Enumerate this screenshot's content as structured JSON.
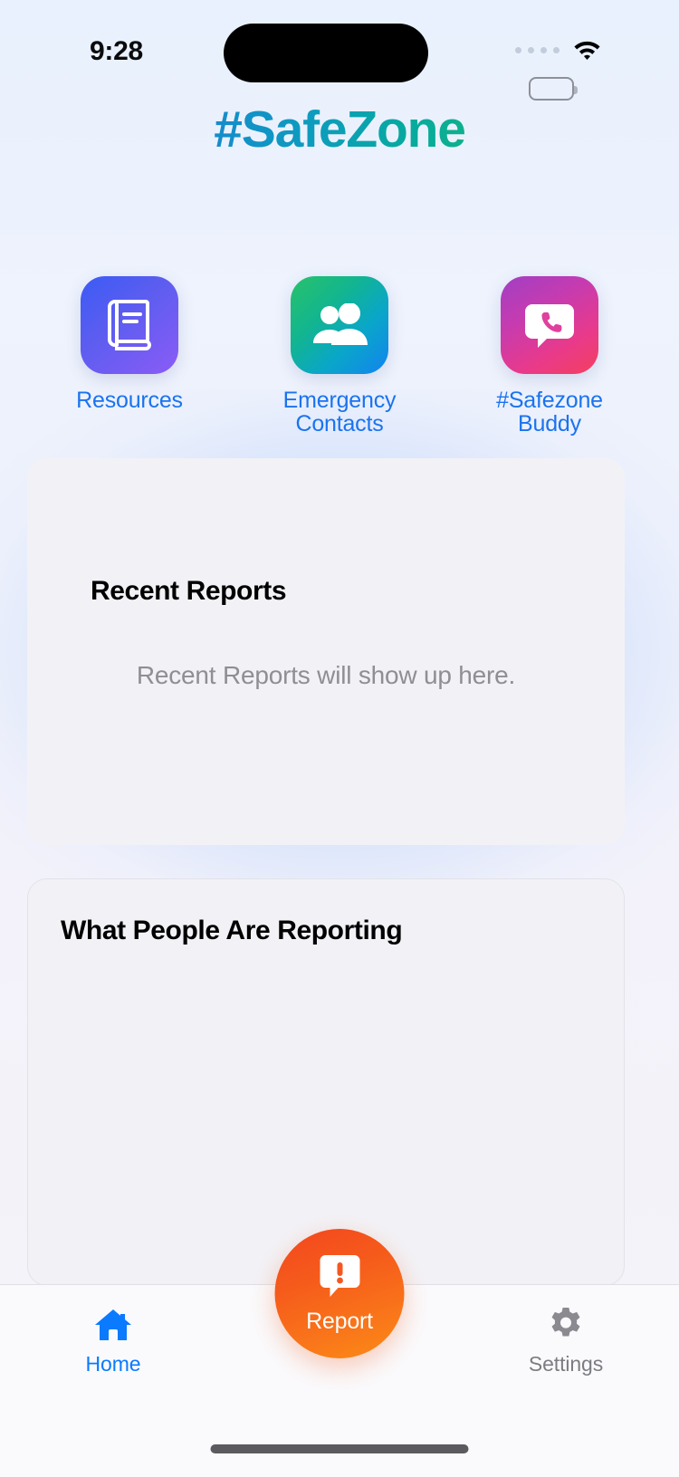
{
  "status_bar": {
    "time": "9:28",
    "signal_icon": "signal-dots-icon",
    "wifi_icon": "wifi-icon",
    "battery_icon": "battery-icon"
  },
  "header": {
    "title": "#SafeZone",
    "title_gradient_from": "#2563eb",
    "title_gradient_to": "#34c759"
  },
  "quick_actions": [
    {
      "label": "Resources",
      "icon": "book-icon",
      "gradient_from": "#3b5bf5",
      "gradient_to": "#8b5cf6"
    },
    {
      "label": "Emergency Contacts",
      "icon": "people-icon",
      "gradient_from": "#29c26a",
      "gradient_to": "#1283f0"
    },
    {
      "label": "#Safezone Buddy",
      "icon": "phone-chat-icon",
      "gradient_from": "#a13fc4",
      "gradient_to": "#f43f5e"
    }
  ],
  "cards": {
    "recent_reports": {
      "title": "Recent Reports",
      "empty_text": "Recent Reports will show up here."
    },
    "what_people_are_reporting": {
      "title": "What People Are Reporting"
    }
  },
  "tab_bar": {
    "home": {
      "label": "Home",
      "icon": "home-icon",
      "color": "#0a7aff"
    },
    "settings": {
      "label": "Settings",
      "icon": "gear-icon",
      "color": "#7c7c83"
    },
    "report_fab": {
      "label": "Report",
      "icon": "alert-chat-icon",
      "color": "#f55a1b"
    }
  }
}
